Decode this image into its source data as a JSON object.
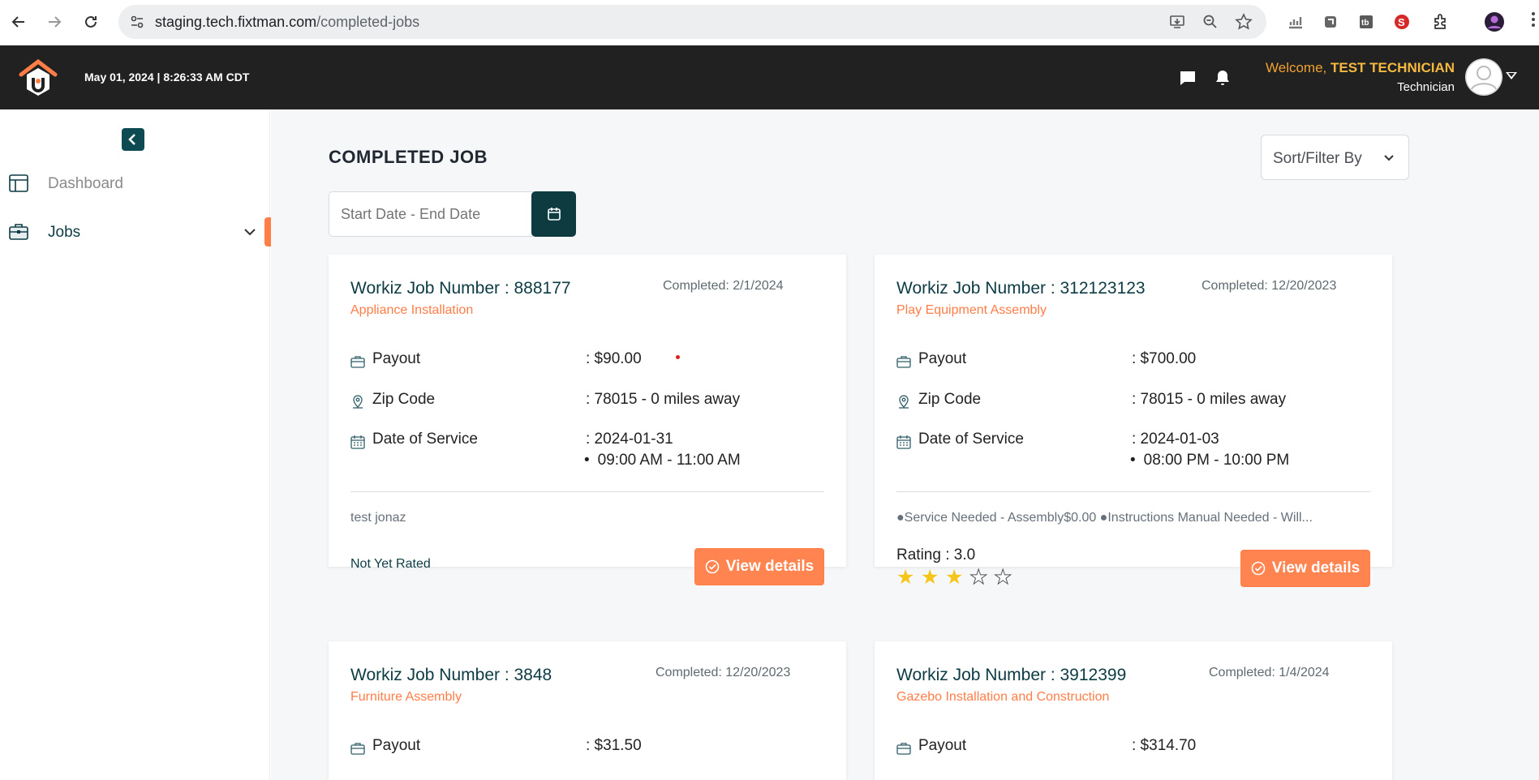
{
  "browser": {
    "url_host": "staging.tech.fixtman.com",
    "url_path": "/completed-jobs"
  },
  "header": {
    "datetime": "May 01, 2024 | 8:26:33 AM CDT",
    "welcome_prefix": "Welcome,",
    "user_name": "TEST TECHNICIAN",
    "role": "Technician"
  },
  "sidebar": {
    "items": [
      {
        "label": "Dashboard",
        "icon": "dashboard-icon"
      },
      {
        "label": "Jobs",
        "icon": "briefcase-icon"
      }
    ]
  },
  "main": {
    "title": "COMPLETED JOB",
    "sort_label": "Sort/Filter By",
    "date_placeholder": "Start Date - End Date",
    "labels": {
      "payout": "Payout",
      "zip": "Zip Code",
      "date": "Date of Service",
      "view": "View details"
    },
    "cards": [
      {
        "job_number": "Workiz Job Number : 888177",
        "completed": "Completed: 2/1/2024",
        "category": "Appliance Installation",
        "payout": ": $90.00",
        "zip": ": 78015 - 0 miles away",
        "date": ": 2024-01-31",
        "time": "09:00 AM - 11:00 AM",
        "note": "test jonaz",
        "rating_text": "Not Yet Rated"
      },
      {
        "job_number": "Workiz Job Number : 312123123",
        "completed": "Completed: 12/20/2023",
        "category": "Play Equipment Assembly",
        "payout": ": $700.00",
        "zip": ": 78015 - 0 miles away",
        "date": ": 2024-01-03",
        "time": "08:00 PM - 10:00 PM",
        "note": "●Service Needed - Assembly$0.00 ●Instructions Manual Needed - Will...",
        "rating_text": "Rating : 3.0",
        "rating": 3,
        "rating_max": 5
      },
      {
        "job_number": "Workiz Job Number : 3848",
        "completed": "Completed: 12/20/2023",
        "category": "Furniture Assembly",
        "payout": ": $31.50"
      },
      {
        "job_number": "Workiz Job Number : 3912399",
        "completed": "Completed: 1/4/2024",
        "category": "Gazebo Installation and Construction",
        "payout": ": $314.70"
      }
    ]
  },
  "colors": {
    "accent": "#ff7d47",
    "brand_dark": "#0d3b44",
    "header_bg": "#212121",
    "star": "#f5c518"
  }
}
